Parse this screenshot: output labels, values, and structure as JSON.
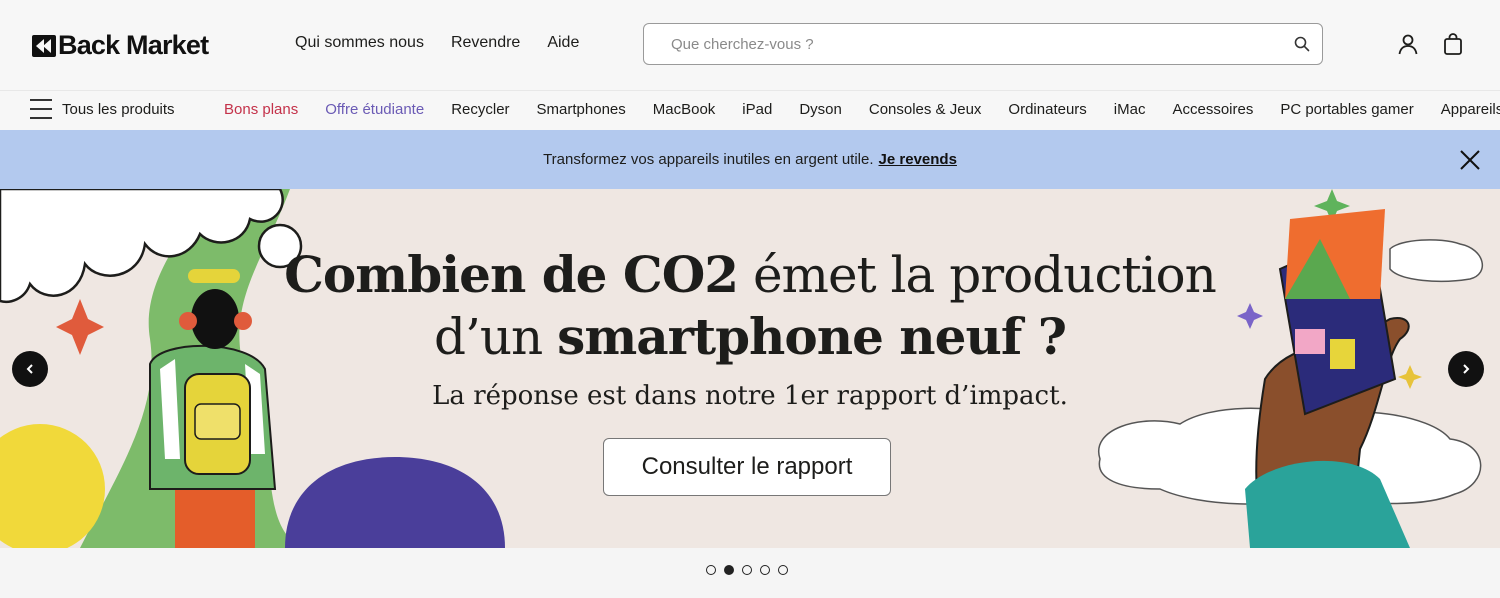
{
  "brand": {
    "name": "Back Market"
  },
  "top_nav": [
    {
      "label": "Qui sommes nous"
    },
    {
      "label": "Revendre"
    },
    {
      "label": "Aide"
    }
  ],
  "search": {
    "placeholder": "Que cherchez-vous ?"
  },
  "menu": {
    "label": "Tous les produits"
  },
  "categories": [
    {
      "label": "Bons plans"
    },
    {
      "label": "Offre étudiante"
    },
    {
      "label": "Recycler"
    },
    {
      "label": "Smartphones"
    },
    {
      "label": "MacBook"
    },
    {
      "label": "iPad"
    },
    {
      "label": "Dyson"
    },
    {
      "label": "Consoles & Jeux"
    },
    {
      "label": "Ordinateurs"
    },
    {
      "label": "iMac"
    },
    {
      "label": "Accessoires"
    },
    {
      "label": "PC portables gamer"
    },
    {
      "label": "Appareils photo"
    }
  ],
  "promo": {
    "text": "Transformez vos appareils inutiles en argent utile.",
    "link": "Je revends"
  },
  "hero": {
    "line1_bold": "Combien de CO2",
    "line1_rest": "émet la production",
    "line2_start": "d’un",
    "line2_bold": "smartphone neuf ?",
    "subtitle": "La réponse est dans notre 1er rapport d’impact.",
    "cta": "Consulter le rapport",
    "slides_total": 5,
    "active_slide": 2
  },
  "colors": {
    "promo_bg": "#b3c9ee",
    "hero_bg": "#efe7e2",
    "deal": "#c4324a",
    "student": "#6b5bb5"
  }
}
